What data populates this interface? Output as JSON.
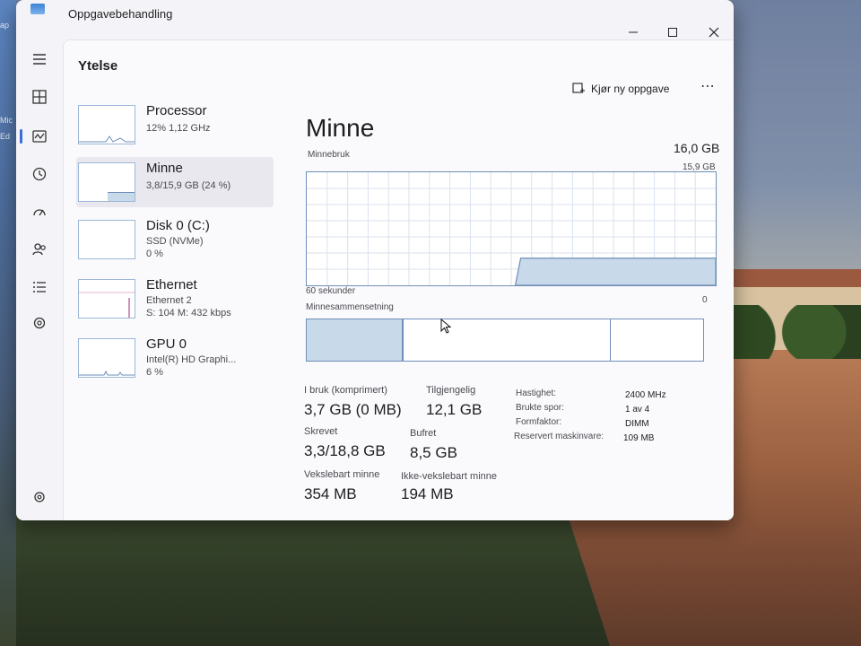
{
  "window": {
    "title": "Oppgavebehandling",
    "controls": {
      "minimize": "—",
      "maximize": "☐",
      "close": "✕"
    }
  },
  "desktop": {
    "left_icons": [
      "ap",
      "Mic",
      "Ed"
    ]
  },
  "nav": {
    "items": [
      {
        "name": "menu-icon"
      },
      {
        "name": "processes-icon"
      },
      {
        "name": "performance-icon",
        "active": true
      },
      {
        "name": "app-history-icon"
      },
      {
        "name": "startup-apps-icon"
      },
      {
        "name": "users-icon"
      },
      {
        "name": "details-icon"
      },
      {
        "name": "services-icon"
      },
      {
        "name": "settings-icon"
      }
    ]
  },
  "page": {
    "title": "Ytelse",
    "run_task_label": "Kjør ny oppgave",
    "more_label": "⋯"
  },
  "perf_list": [
    {
      "name": "Processor",
      "sub1": "12% 1,12 GHz",
      "sub2": "",
      "selected": false
    },
    {
      "name": "Minne",
      "sub1": "3,8/15,9 GB (24 %)",
      "sub2": "",
      "selected": true
    },
    {
      "name": "Disk 0 (C:)",
      "sub1": "SSD (NVMe)",
      "sub2": "0 %",
      "selected": false
    },
    {
      "name": "Ethernet",
      "sub1": "Ethernet 2",
      "sub2": "S: 104 M: 432 kbps",
      "selected": false
    },
    {
      "name": "GPU 0",
      "sub1": "Intel(R) HD Graphi...",
      "sub2": "6 %",
      "selected": false
    }
  ],
  "detail": {
    "title": "Minne",
    "total": "16,0 GB",
    "usage_label": "Minnebruk",
    "usage_max": "15,9 GB",
    "time_label": "60 sekunder",
    "zero_label": "0",
    "composition_label": "Minnesammensetning",
    "usage_fraction": 0.24,
    "stats": [
      {
        "label": "I bruk (komprimert)",
        "value": "3,7 GB (0 MB)"
      },
      {
        "label": "Tilgjengelig",
        "value": "12,1 GB"
      },
      {
        "label": "Skrevet",
        "value": "3,3/18,8 GB"
      },
      {
        "label": "Bufret",
        "value": "8,5 GB"
      },
      {
        "label": "Vekslebart minne",
        "value": "354 MB"
      },
      {
        "label": "Ikke-vekslebart minne",
        "value": "194 MB"
      }
    ],
    "specs": [
      {
        "key": "Hastighet:",
        "value": "2400 MHz"
      },
      {
        "key": "Brukte spor:",
        "value": "1 av 4"
      },
      {
        "key": "Formfaktor:",
        "value": "DIMM"
      },
      {
        "key": "Reservert maskinvare:",
        "value": "109 MB"
      }
    ]
  },
  "colors": {
    "accent": "#3b6fd6",
    "graph_line": "#6f8fb8",
    "graph_fill": "#c8d9ea"
  }
}
